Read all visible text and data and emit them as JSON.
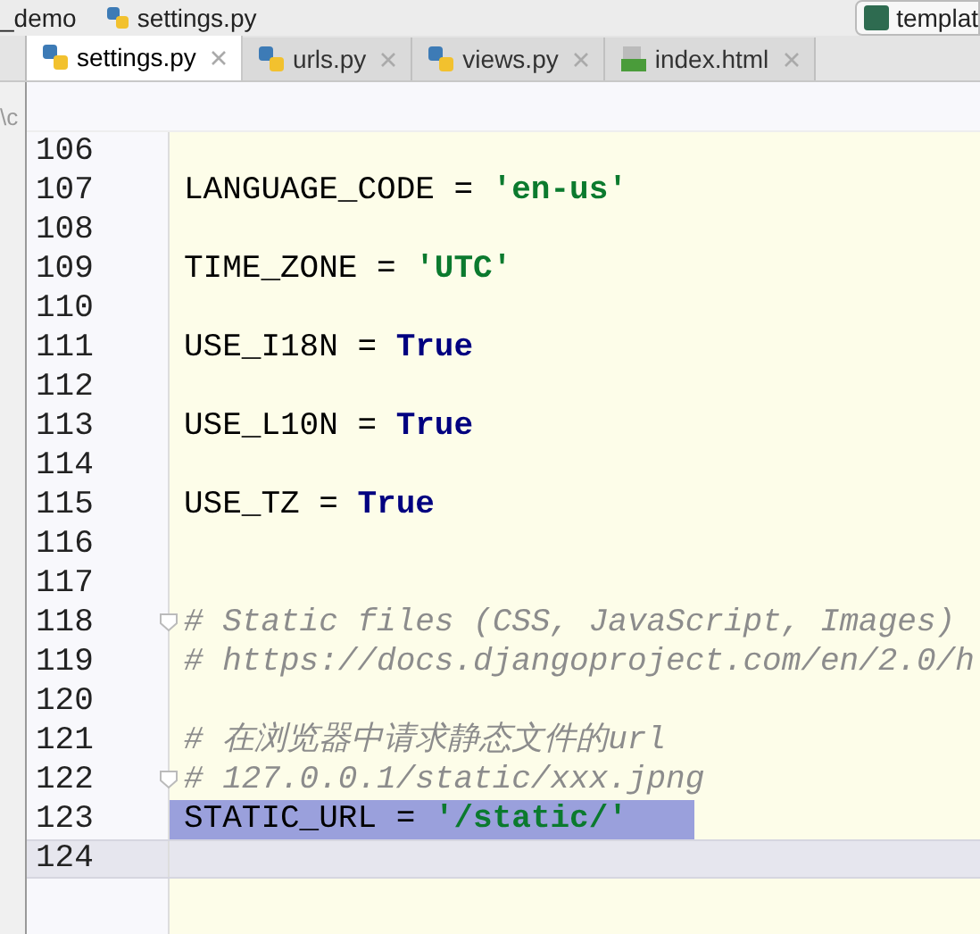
{
  "breadcrumbs": [
    {
      "label": "_demo"
    },
    {
      "label": "settings.py"
    }
  ],
  "template_button": {
    "label": "templat"
  },
  "tabs": [
    {
      "label": "settings.py",
      "kind": "python",
      "selected": true
    },
    {
      "label": "urls.py",
      "kind": "python",
      "selected": false
    },
    {
      "label": "views.py",
      "kind": "python",
      "selected": false
    },
    {
      "label": "index.html",
      "kind": "html",
      "selected": false
    }
  ],
  "side_text": "\\c",
  "lines": [
    {
      "number": "106",
      "selected": false,
      "current": false,
      "fold": false
    },
    {
      "number": "107",
      "tokens": [
        {
          "kind": "plain",
          "text": "LANGUAGE_CODE = "
        },
        {
          "kind": "string",
          "text": "'en-us'"
        }
      ],
      "selected": false,
      "current": false,
      "fold": false
    },
    {
      "number": "108",
      "selected": false,
      "current": false,
      "fold": false
    },
    {
      "number": "109",
      "tokens": [
        {
          "kind": "plain",
          "text": "TIME_ZONE = "
        },
        {
          "kind": "string",
          "text": "'UTC'"
        }
      ],
      "selected": false,
      "current": false,
      "fold": false
    },
    {
      "number": "110",
      "selected": false,
      "current": false,
      "fold": false
    },
    {
      "number": "111",
      "tokens": [
        {
          "kind": "plain",
          "text": "USE_I18N = "
        },
        {
          "kind": "keyword",
          "text": "True"
        }
      ],
      "selected": false,
      "current": false,
      "fold": false
    },
    {
      "number": "112",
      "selected": false,
      "current": false,
      "fold": false
    },
    {
      "number": "113",
      "tokens": [
        {
          "kind": "plain",
          "text": "USE_L10N = "
        },
        {
          "kind": "keyword",
          "text": "True"
        }
      ],
      "selected": false,
      "current": false,
      "fold": false
    },
    {
      "number": "114",
      "selected": false,
      "current": false,
      "fold": false
    },
    {
      "number": "115",
      "tokens": [
        {
          "kind": "plain",
          "text": "USE_TZ = "
        },
        {
          "kind": "keyword",
          "text": "True"
        }
      ],
      "selected": false,
      "current": false,
      "fold": false
    },
    {
      "number": "116",
      "selected": false,
      "current": false,
      "fold": false
    },
    {
      "number": "117",
      "selected": false,
      "current": false,
      "fold": false
    },
    {
      "number": "118",
      "tokens": [
        {
          "kind": "comment",
          "text": "# Static files (CSS, JavaScript, Images)"
        }
      ],
      "selected": false,
      "current": false,
      "fold": true
    },
    {
      "number": "119",
      "tokens": [
        {
          "kind": "comment",
          "text": "# https://docs.djangoproject.com/en/2.0/h"
        }
      ],
      "selected": false,
      "current": false,
      "fold": false
    },
    {
      "number": "120",
      "selected": false,
      "current": false,
      "fold": false
    },
    {
      "number": "121",
      "tokens": [
        {
          "kind": "comment",
          "text": "# 在浏览器中请求静态文件的url"
        }
      ],
      "selected": false,
      "current": false,
      "fold": false
    },
    {
      "number": "122",
      "tokens": [
        {
          "kind": "comment",
          "text": "# 127.0.0.1/static/xxx.jpng"
        }
      ],
      "selected": false,
      "current": false,
      "fold": true
    },
    {
      "number": "123",
      "tokens": [
        {
          "kind": "plain",
          "text": "STATIC_URL = "
        },
        {
          "kind": "string",
          "text": "'/static/'"
        }
      ],
      "selected": true,
      "current": false,
      "fold": false
    },
    {
      "number": "124",
      "selected": false,
      "current": true,
      "fold": false
    }
  ]
}
